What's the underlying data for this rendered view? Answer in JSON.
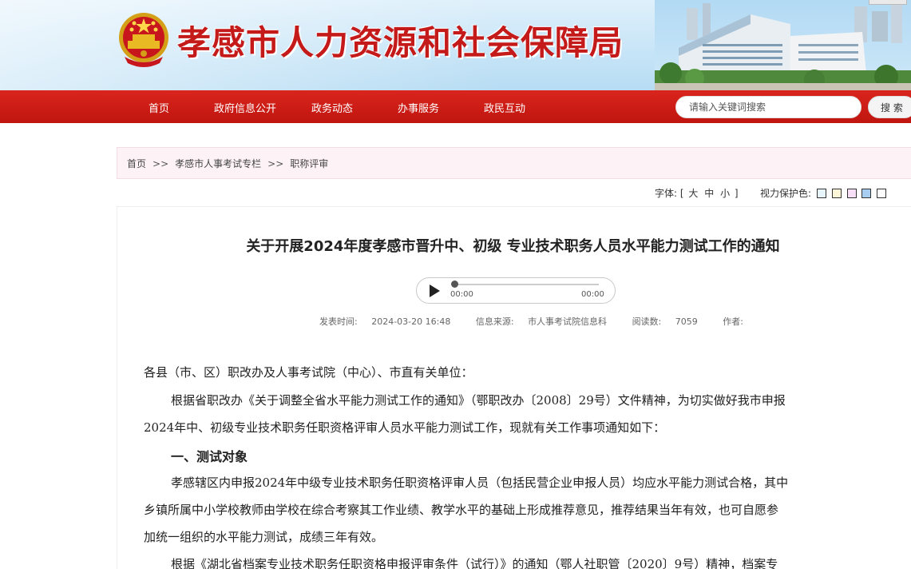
{
  "header": {
    "site_title": "孝感市人力资源和社会保障局"
  },
  "nav": {
    "items": [
      "首页",
      "政府信息公开",
      "政务动态",
      "办事服务",
      "政民互动"
    ],
    "search_placeholder": "请输入关键词搜索",
    "search_button": "搜 索"
  },
  "breadcrumb": {
    "items": [
      "首页",
      "孝感市人事考试专栏",
      "职称评审"
    ],
    "separator": ">>"
  },
  "tools": {
    "font_label": "字体:",
    "font_open": "[",
    "font_sizes": [
      "大",
      "中",
      "小"
    ],
    "font_close": "]",
    "vision_label": "视力保护色:",
    "swatch_colors": [
      "#e7f5fd",
      "#fff6d8",
      "#f6dff7",
      "#a8cdf3",
      "#ffffff"
    ]
  },
  "article": {
    "title": "关于开展2024年度孝感市晋升中、初级 专业技术职务人员水平能力测试工作的通知",
    "audio": {
      "current_time": "00:00",
      "duration": "00:00"
    },
    "meta": {
      "publish_label": "发表时间:",
      "publish_time": "2024-03-20 16:48",
      "source_label": "信息来源:",
      "source": "市人事考试院信息科",
      "views_label": "阅读数:",
      "views": "7059",
      "author_label": "作者:"
    },
    "paragraphs": [
      "各县（市、区）职改办及人事考试院（中心）、市直有关单位：",
      "根据省职改办《关于调整全省水平能力测试工作的通知》（鄂职改办〔2008〕29号）文件精神，为切实做好我市申报",
      "2024年中、初级专业技术职务任职资格评审人员水平能力测试工作，现就有关工作事项通知如下：",
      "一、测试对象",
      "孝感辖区内申报2024年中级专业技术职务任职资格评审人员（包括民营企业申报人员）均应水平能力测试合格，其中",
      "乡镇所属中小学校教师由学校在综合考察其工作业绩、教学水平的基础上形成推荐意见，推荐结果当年有效，也可自愿参",
      "加统一组织的水平能力测试，成绩三年有效。",
      "根据《湖北省档案专业技术职务任职资格申报评审条件（试行）》的通知（鄂人社职管〔2020〕9号）精神，档案专"
    ]
  }
}
